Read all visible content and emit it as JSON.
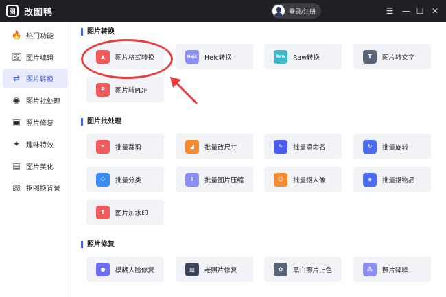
{
  "app": {
    "title": "改图鸭",
    "logo_glyph": "图"
  },
  "header": {
    "login_label": "登录/注册"
  },
  "window_controls": {
    "menu": "☰",
    "minimize": "—",
    "maximize": "☐",
    "close": "✕"
  },
  "sidebar": {
    "items": [
      {
        "label": "热门功能",
        "icon": "flame-icon",
        "glyph": "🔥"
      },
      {
        "label": "图片编辑",
        "icon": "image-edit-icon",
        "glyph": "🖼"
      },
      {
        "label": "图片转换",
        "icon": "convert-icon",
        "glyph": "⇄"
      },
      {
        "label": "图片批处理",
        "icon": "batch-icon",
        "glyph": "◉"
      },
      {
        "label": "照片修复",
        "icon": "photo-repair-icon",
        "glyph": "▣"
      },
      {
        "label": "趣味特效",
        "icon": "magic-icon",
        "glyph": "✦"
      },
      {
        "label": "图片美化",
        "icon": "beautify-icon",
        "glyph": "▤"
      },
      {
        "label": "抠图换背景",
        "icon": "cutout-icon",
        "glyph": "▧"
      }
    ]
  },
  "sections": [
    {
      "title": "图片转换",
      "cards": [
        {
          "label": "图片格式转换",
          "icon": "image-format-icon",
          "glyph": "▲",
          "color": "#f25a5a"
        },
        {
          "label": "Heic转换",
          "icon": "heic-icon",
          "glyph": "Heic",
          "color": "#8b8ef5"
        },
        {
          "label": "Raw转换",
          "icon": "raw-icon",
          "glyph": "Raw",
          "color": "#3fb8c9"
        },
        {
          "label": "图片转文字",
          "icon": "image-to-text-icon",
          "glyph": "T",
          "color": "#5a6478"
        },
        {
          "label": "图片转PDF",
          "icon": "image-to-pdf-icon",
          "glyph": "P",
          "color": "#f25a5a"
        }
      ]
    },
    {
      "title": "图片批处理",
      "cards": [
        {
          "label": "批量裁剪",
          "icon": "batch-crop-icon",
          "glyph": "⌗",
          "color": "#f25a5a"
        },
        {
          "label": "批量改尺寸",
          "icon": "batch-resize-icon",
          "glyph": "◢",
          "color": "#f5892e"
        },
        {
          "label": "批量重命名",
          "icon": "batch-rename-icon",
          "glyph": "✎",
          "color": "#4a5cf0"
        },
        {
          "label": "批量旋转",
          "icon": "batch-rotate-icon",
          "glyph": "↻",
          "color": "#4a6cf0"
        },
        {
          "label": "批量分类",
          "icon": "batch-classify-icon",
          "glyph": "⁘",
          "color": "#3a8cf5"
        },
        {
          "label": "批量图片压缩",
          "icon": "batch-compress-icon",
          "glyph": "⇕",
          "color": "#8b8ef5"
        },
        {
          "label": "批量抠人像",
          "icon": "batch-portrait-icon",
          "glyph": "☺",
          "color": "#f5892e"
        },
        {
          "label": "批量抠物品",
          "icon": "batch-object-icon",
          "glyph": "◈",
          "color": "#4a6cf0"
        },
        {
          "label": "图片加水印",
          "icon": "watermark-icon",
          "glyph": "E",
          "color": "#f25a5a"
        }
      ]
    },
    {
      "title": "照片修复",
      "cards": [
        {
          "label": "模糊人脸修复",
          "icon": "face-repair-icon",
          "glyph": "●",
          "color": "#6b6ef5"
        },
        {
          "label": "老照片修复",
          "icon": "old-photo-icon",
          "glyph": "▨",
          "color": "#3a4358"
        },
        {
          "label": "黑白照片上色",
          "icon": "colorize-icon",
          "glyph": "✿",
          "color": "#5a6478"
        },
        {
          "label": "照片降噪",
          "icon": "denoise-icon",
          "glyph": "⁂",
          "color": "#8b8ef5"
        }
      ]
    }
  ]
}
